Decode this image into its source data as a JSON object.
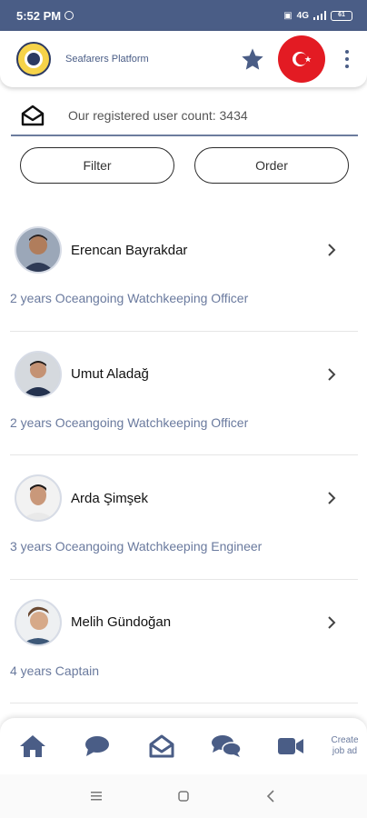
{
  "status_bar": {
    "time": "5:52 PM",
    "network": "4G",
    "battery": "61"
  },
  "header": {
    "title": "Seafarers Platform",
    "logo": "seafarers-logo",
    "favorite_icon": "star-icon",
    "language_flag": "turkey-flag-icon",
    "menu_icon": "more-vertical-icon"
  },
  "user_count": {
    "icon": "envelope-open-icon",
    "text": "Our registered user count: 3434"
  },
  "filters": {
    "filter_label": "Filter",
    "order_label": "Order"
  },
  "users": [
    {
      "name": "Erencan Bayrakdar",
      "experience": "2 years Oceangoing Watchkeeping Officer"
    },
    {
      "name": "Umut Aladağ",
      "experience": "2 years Oceangoing Watchkeeping Officer"
    },
    {
      "name": "Arda Şimşek",
      "experience": "3 years Oceangoing Watchkeeping Engineer"
    },
    {
      "name": "Melih Gündoğan",
      "experience": "4 years Captain"
    }
  ],
  "bottom_nav": {
    "items": [
      "home-icon",
      "chat-bubble-icon",
      "envelope-open-icon",
      "conversations-icon",
      "video-camera-icon"
    ],
    "create_label": "Create\njob ad"
  },
  "colors": {
    "primary": "#4a5d86",
    "flag_red": "#e31b23",
    "muted_text": "#6a7a9e"
  }
}
